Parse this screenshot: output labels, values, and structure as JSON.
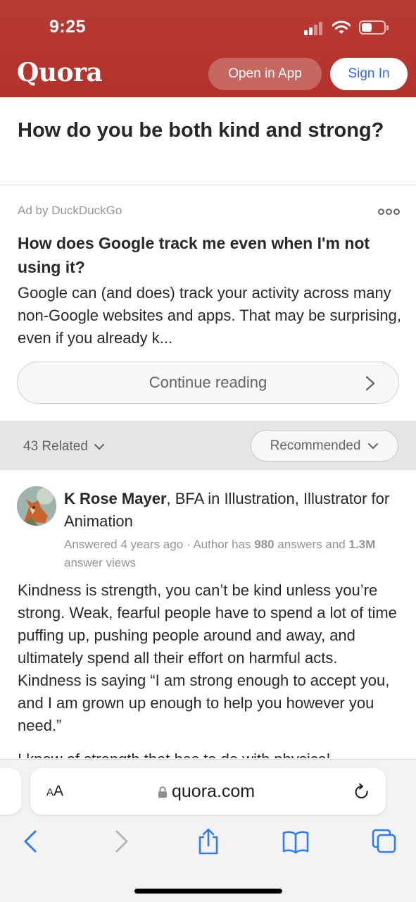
{
  "status_bar": {
    "time": "9:25"
  },
  "header": {
    "logo": "Quora",
    "open_in_app": "Open in App",
    "sign_in": "Sign In",
    "brand_color": "#b92b27"
  },
  "question": {
    "title": "How do you be both kind and strong?"
  },
  "ad": {
    "label": "Ad by DuckDuckGo",
    "title": "How does Google track me even when I'm not using it?",
    "body": "Google can (and does) track your activity across many non-Google websites and apps. That may be surprising, even if you already k...",
    "cta": "Continue reading"
  },
  "filters": {
    "related": "43 Related",
    "sort": "Recommended"
  },
  "answer": {
    "author_name": "K Rose Mayer",
    "author_credential": ", BFA in Illustration, Illustrator for Animation",
    "meta_prefix": "Answered 4 years ago · Author has ",
    "answers_count": "980",
    "meta_middle": " answers and ",
    "views_count": "1.3M",
    "meta_suffix": " answer views",
    "text": "Kindness is strength, you can’t be kind unless you’re strong. Weak, fearful people have to spend a lot of time puffing up, pushing people around and away, and ultimately spend all their effort on harmful acts. Kindness is saying “I am strong enough to accept you, and I am grown up enough to help you however you need.”",
    "text_cut": "I know of strength that has to do with physical"
  },
  "browser": {
    "aa_label": "AA",
    "url": "quora.com",
    "icons": [
      "back-icon",
      "forward-icon",
      "share-icon",
      "bookmarks-icon",
      "tabs-icon"
    ]
  }
}
